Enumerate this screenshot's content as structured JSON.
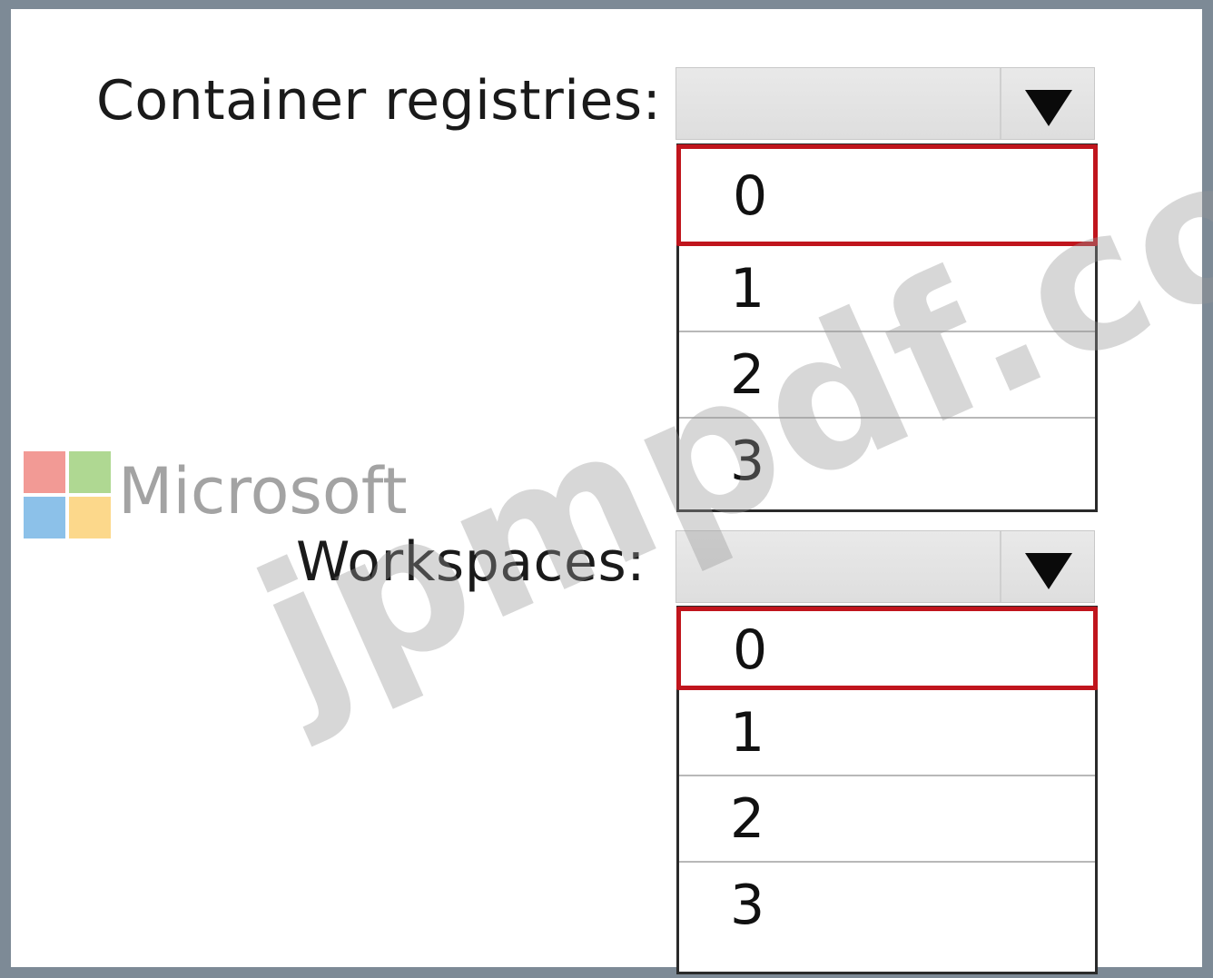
{
  "questions": [
    {
      "label": "Container registries:",
      "options": [
        "0",
        "1",
        "2",
        "3"
      ],
      "selected_index": 0
    },
    {
      "label": "Workspaces:",
      "options": [
        "0",
        "1",
        "2",
        "3"
      ],
      "selected_index": 0
    }
  ],
  "branding": {
    "logo_text": "Microsoft"
  },
  "watermark": {
    "text": "jpmpdf.com"
  },
  "colors": {
    "selection_border": "#c0151d",
    "frame_border": "#7d8a96"
  }
}
